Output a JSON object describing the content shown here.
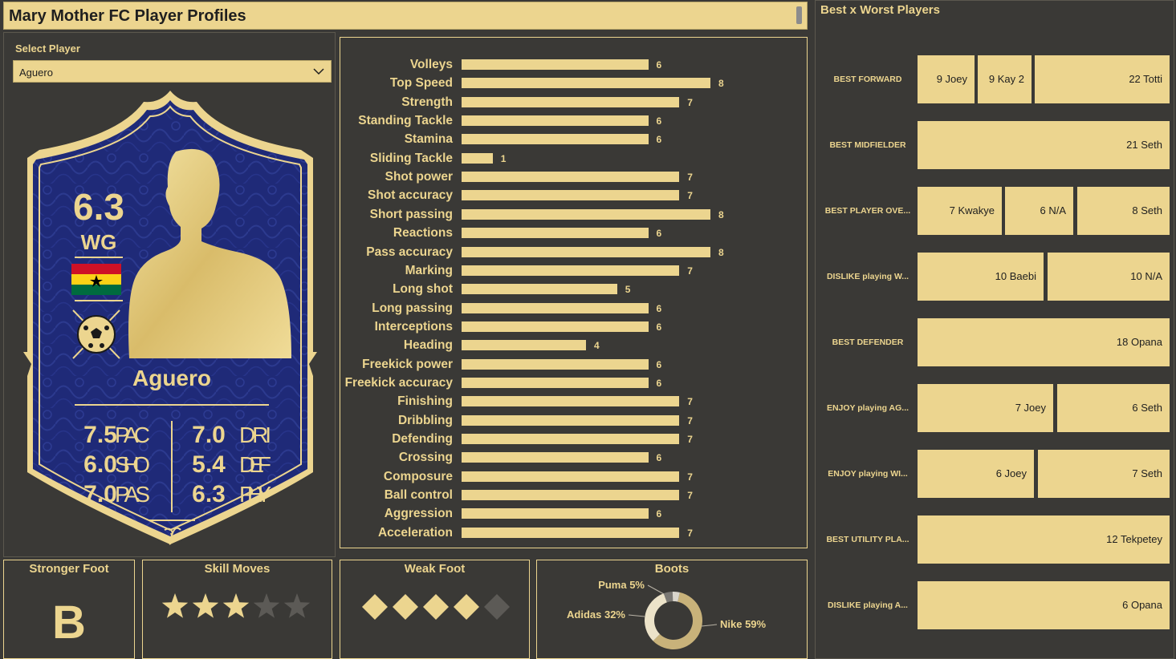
{
  "title": "Mary Mother FC Player Profiles",
  "select": {
    "label": "Select Player",
    "value": "Aguero"
  },
  "card": {
    "rating": "6.3",
    "position": "WG",
    "name": "Aguero",
    "attrs": [
      {
        "value": "7.5",
        "label": "PAC"
      },
      {
        "value": "6.0",
        "label": "SHO"
      },
      {
        "value": "7.0",
        "label": "PAS"
      },
      {
        "value": "7.0",
        "label": "DRI"
      },
      {
        "value": "5.4",
        "label": "DEF"
      },
      {
        "value": "6.3",
        "label": "PHY"
      }
    ],
    "colors": {
      "card_blue": "#1f2a78",
      "gold": "#ecd58f"
    }
  },
  "chart_data": {
    "type": "bar",
    "orientation": "horizontal",
    "categories": [
      "Volleys",
      "Top Speed",
      "Strength",
      "Standing Tackle",
      "Stamina",
      "Sliding Tackle",
      "Shot power",
      "Shot accuracy",
      "Short passing",
      "Reactions",
      "Pass accuracy",
      "Marking",
      "Long shot",
      "Long passing",
      "Interceptions",
      "Heading",
      "Freekick power",
      "Freekick accuracy",
      "Finishing",
      "Dribbling",
      "Defending",
      "Crossing",
      "Composure",
      "Ball control",
      "Aggression",
      "Acceleration"
    ],
    "values": [
      6,
      8,
      7,
      6,
      6,
      1,
      7,
      7,
      8,
      6,
      8,
      7,
      5,
      6,
      6,
      4,
      6,
      6,
      7,
      7,
      7,
      6,
      7,
      7,
      6,
      7
    ],
    "xlim": [
      0,
      8
    ],
    "color": "#ecd58f"
  },
  "stronger_foot": {
    "header": "Stronger Foot",
    "value": "B"
  },
  "skill_moves": {
    "header": "Skill Moves",
    "rating": 3,
    "max": 5
  },
  "weak_foot": {
    "header": "Weak Foot",
    "rating": 4,
    "max": 5
  },
  "boots": {
    "header": "Boots",
    "slices": [
      {
        "label": "Nike",
        "percent": 59,
        "text": "Nike 59%",
        "color": "#c8b27a"
      },
      {
        "label": "Adidas",
        "percent": 32,
        "text": "Adidas 32%",
        "color": "#ece3c9"
      },
      {
        "label": "Puma",
        "percent": 5,
        "text": "Puma 5%",
        "color": "#7a7874"
      },
      {
        "label": "Other",
        "percent": 4,
        "text": "",
        "color": "#d9d5cc"
      }
    ]
  },
  "best_worst": {
    "title": "Best x Worst Players",
    "rows": [
      {
        "label": "BEST FORWARD",
        "cells": [
          "9 Joey",
          "9 Kay 2",
          "22 Totti"
        ]
      },
      {
        "label": "BEST MIDFIELDER",
        "cells": [
          "21 Seth"
        ]
      },
      {
        "label": "BEST PLAYER OVE...",
        "cells": [
          "7 Kwakye",
          "6 N/A",
          "8 Seth"
        ]
      },
      {
        "label": "DISLIKE playing W...",
        "cells": [
          "10 Baebi",
          "10 N/A"
        ]
      },
      {
        "label": "BEST DEFENDER",
        "cells": [
          "18 Opana"
        ]
      },
      {
        "label": "ENJOY playing AG...",
        "cells": [
          "7 Joey",
          "6 Seth"
        ]
      },
      {
        "label": "ENJOY playing WI...",
        "cells": [
          "6 Joey",
          "7 Seth"
        ]
      },
      {
        "label": "BEST UTILITY PLA...",
        "cells": [
          "12 Tekpetey"
        ]
      },
      {
        "label": "DISLIKE playing A...",
        "cells": [
          "6 Opana"
        ]
      }
    ]
  }
}
